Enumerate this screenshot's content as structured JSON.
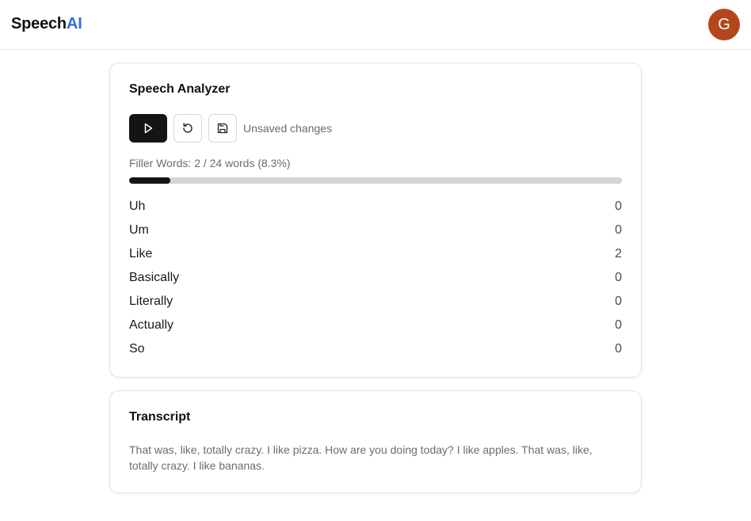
{
  "header": {
    "brand_main": "Speech",
    "brand_accent": "AI",
    "avatar_initial": "G",
    "avatar_color": "#b5451b",
    "accent_color": "#2f6fde"
  },
  "analyzer": {
    "title": "Speech Analyzer",
    "play_icon": "play-icon",
    "reset_icon": "reset-icon",
    "save_icon": "save-icon",
    "status": "Unsaved changes",
    "filler_summary": "Filler Words: 2 / 24 words (8.3%)",
    "filler_fraction": 0.083,
    "words": [
      {
        "label": "Uh",
        "count": "0"
      },
      {
        "label": "Um",
        "count": "0"
      },
      {
        "label": "Like",
        "count": "2"
      },
      {
        "label": "Basically",
        "count": "0"
      },
      {
        "label": "Literally",
        "count": "0"
      },
      {
        "label": "Actually",
        "count": "0"
      },
      {
        "label": "So",
        "count": "0"
      }
    ]
  },
  "transcript": {
    "title": "Transcript",
    "text": "That was, like, totally crazy. I like pizza. How are you doing today? I like apples. That was, like, totally crazy. I like bananas."
  }
}
